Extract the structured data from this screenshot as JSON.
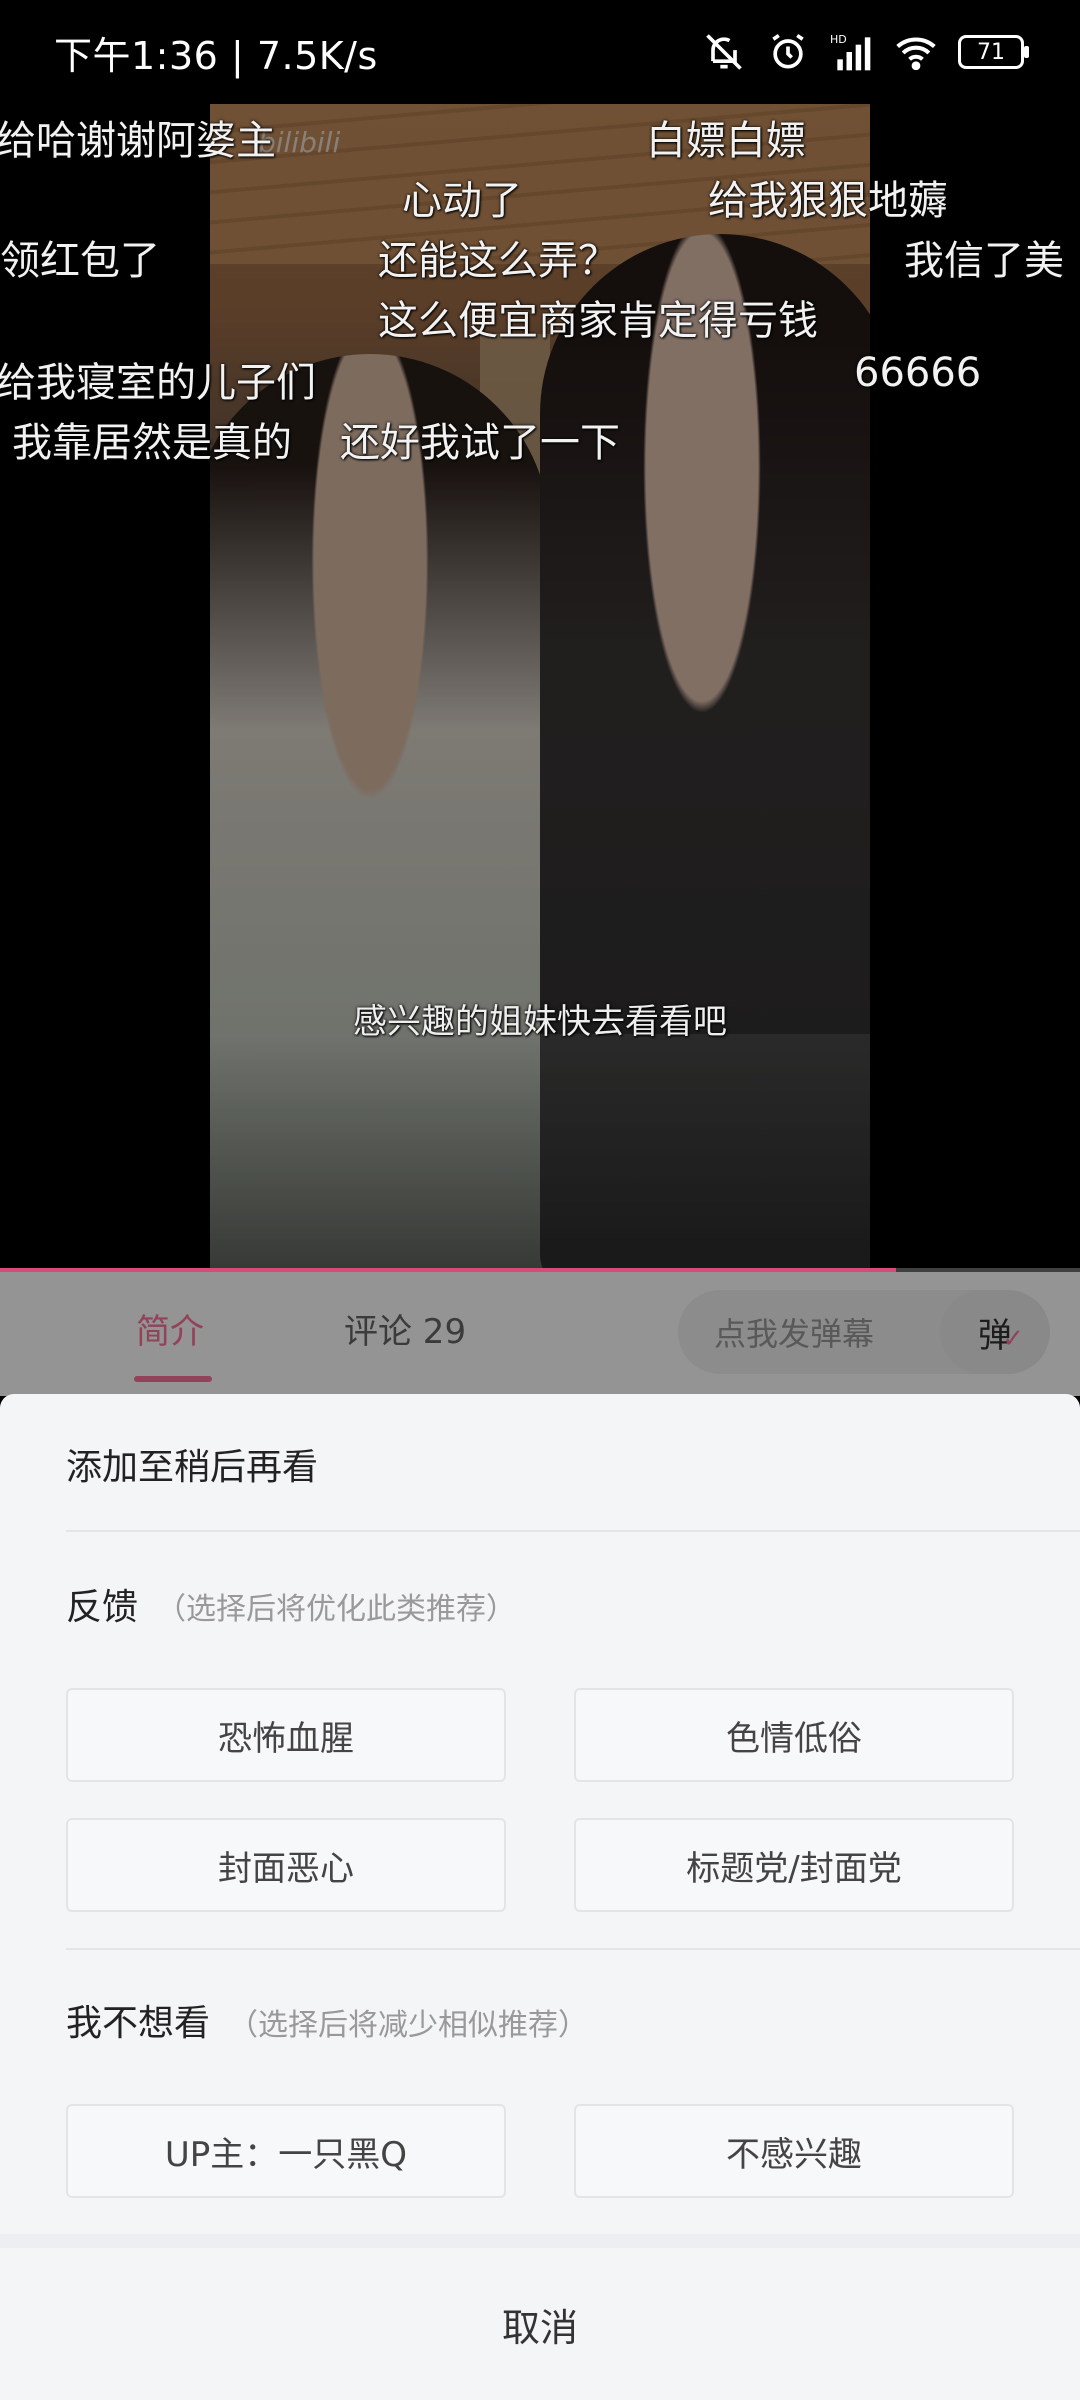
{
  "status_bar": {
    "time": "下午1:36",
    "net_speed": "7.5K/s",
    "battery": "71",
    "icons": [
      "bell-off-icon",
      "alarm-icon",
      "hd-signal-icon",
      "wifi-icon",
      "battery-icon"
    ]
  },
  "video": {
    "watermark": "bilibili",
    "danmaku": [
      "给哈谢谢阿婆主",
      "白嫖白嫖",
      "心动了",
      "给我狠狠地薅",
      "领红包了",
      "还能这么弄？",
      "我信了美",
      "这么便宜商家肯定得亏钱",
      "给我寝室的儿子们",
      "66666",
      "我靠居然是真的",
      "还好我试了一下"
    ],
    "subtitle": "感兴趣的姐妹快去看看吧",
    "progress": 0.83
  },
  "tabs": {
    "intro": "简介",
    "comments": "评论 29",
    "danmaku_placeholder": "点我发弹幕",
    "danmaku_button": "弹"
  },
  "sheet": {
    "watch_later": "添加至稍后再看",
    "feedback_title": "反馈",
    "feedback_hint": "（选择后将优化此类推荐）",
    "feedback_options": [
      "恐怖血腥",
      "色情低俗",
      "封面恶心",
      "标题党/封面党"
    ],
    "dislike_title": "我不想看",
    "dislike_hint": "（选择后将减少相似推荐）",
    "dislike_options": [
      "UP主：一只黑Q",
      "不感兴趣"
    ],
    "cancel": "取消"
  },
  "colors": {
    "accent": "#fb7299",
    "sheet_bg": "#f4f5f7"
  }
}
